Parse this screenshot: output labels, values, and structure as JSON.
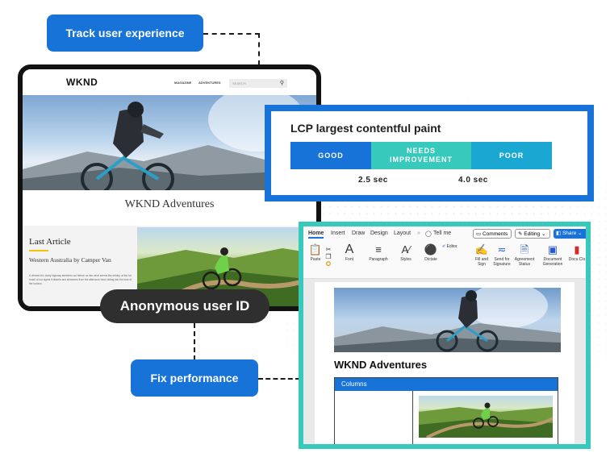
{
  "callouts": {
    "track": "Track user experience",
    "anonymous": "Anonymous user ID",
    "fix": "Fix performance"
  },
  "site": {
    "logo": "WKND",
    "nav": [
      "MAGAZINE",
      "ADVENTURES"
    ],
    "search_placeholder": "SEARCH",
    "hero_title": "WKND Adventures",
    "last_article_heading": "Last Article",
    "article_title": "Western Australia by Camper Van",
    "article_body": "A vibrant red, dusty highway stretches out before us into what seems like infinity, at the far reach of our sights it distorts and shimmers from the afternoon heat, fading into the blue of the horizon."
  },
  "lcp": {
    "title": "LCP largest contentful paint",
    "segments": [
      {
        "label": "GOOD",
        "color": "#1773d8"
      },
      {
        "label": "NEEDS IMPROVEMENT",
        "color": "#37c9bc"
      },
      {
        "label": "POOR",
        "color": "#1aa8d2"
      }
    ],
    "thresholds": [
      "2.5 sec",
      "4.0 sec"
    ]
  },
  "word": {
    "tabs": [
      "Home",
      "Insert",
      "Draw",
      "Design",
      "Layout",
      "Tell me"
    ],
    "comments": "Comments",
    "editing": "Editing",
    "share": "Share",
    "buttons": {
      "paste": "Paste",
      "font": "Font",
      "paragraph": "Paragraph",
      "styles": "Styles",
      "dictate": "Dictate",
      "editor": "Editor",
      "fill_sign": "Fill and Sign",
      "send_signature": "Send for Signature",
      "agreement_status": "Agreement Status",
      "doc_generation": "Document Generation",
      "doc_cloud": "Docu Clo"
    },
    "doc_title": "WKND Adventures",
    "columns_label": "Columns"
  },
  "colors": {
    "accent_blue": "#1773d8",
    "teal": "#37c9bc",
    "dark": "#2f2f2f"
  }
}
